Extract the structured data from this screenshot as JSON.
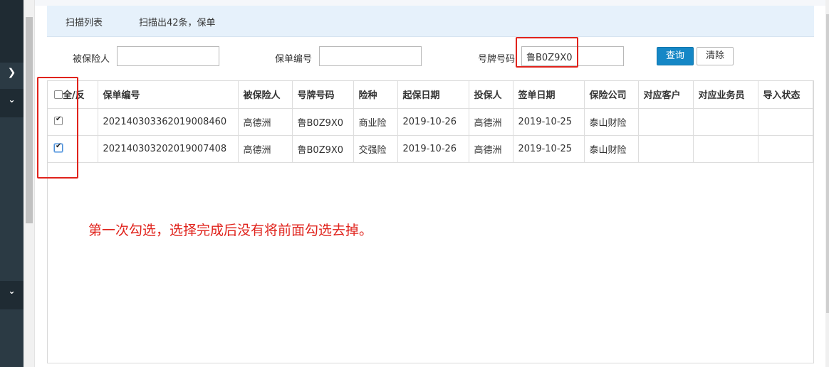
{
  "header": {
    "tab_scan_list": "扫描列表",
    "tab_scan_result": "扫描出42条，保单"
  },
  "filters": {
    "insured_label": "被保险人",
    "insured_value": "",
    "policy_no_label": "保单编号",
    "policy_no_value": "",
    "plate_label": "号牌号码",
    "plate_value": "鲁B0Z9X0"
  },
  "buttons": {
    "query": "查询",
    "clear": "清除"
  },
  "table": {
    "select_all_label": "全/反",
    "columns": [
      "保单编号",
      "被保险人",
      "号牌号码",
      "险种",
      "起保日期",
      "投保人",
      "签单日期",
      "保险公司",
      "对应客户",
      "对应业务员",
      "导入状态"
    ],
    "rows": [
      {
        "checked": true,
        "policy_no": "202140303362019008460",
        "insured": "高德洲",
        "plate": "鲁B0Z9X0",
        "type": "商业险",
        "start_date": "2019-10-26",
        "applicant": "高德洲",
        "sign_date": "2019-10-25",
        "company": "泰山财险",
        "customer": "",
        "salesperson": "",
        "import_status": ""
      },
      {
        "checked": true,
        "policy_no": "202140303202019007408",
        "insured": "高德洲",
        "plate": "鲁B0Z9X0",
        "type": "交强险",
        "start_date": "2019-10-26",
        "applicant": "高德洲",
        "sign_date": "2019-10-25",
        "company": "泰山财险",
        "customer": "",
        "salesperson": "",
        "import_status": ""
      }
    ]
  },
  "annotation": "第一次勾选，选择完成后没有将前面勾选去掉。",
  "colors": {
    "sidebar": "#2b3a44",
    "header_bg": "#e6f1fb",
    "primary_button": "#1587c6",
    "annotation_red": "#e0231c"
  },
  "icons": [
    "chevron-right-icon",
    "chevron-down-icon",
    "chevron-down-icon"
  ]
}
